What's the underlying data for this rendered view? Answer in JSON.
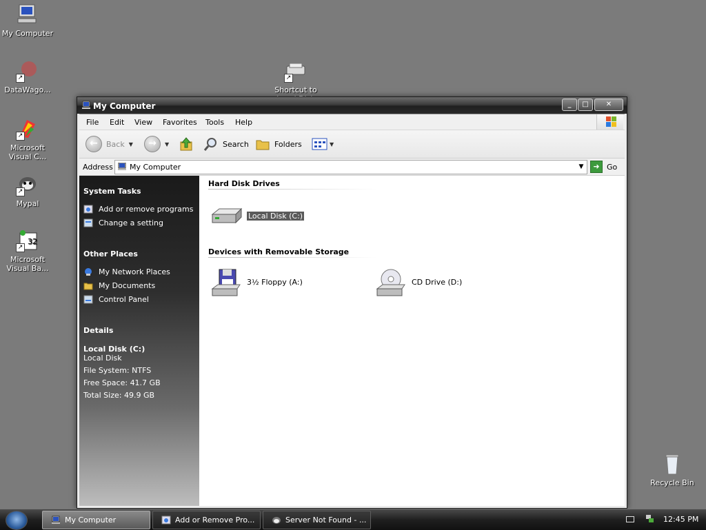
{
  "desktop": {
    "icons": [
      {
        "label": "My Computer",
        "icon": "my-computer-icon"
      },
      {
        "label": "DataWago...",
        "icon": "datawagon-icon"
      },
      {
        "label": "Shortcut to Local Disk (C...",
        "icon": "drive-shortcut-icon"
      },
      {
        "label": "Microsoft Visual C...",
        "icon": "visual-c-icon"
      },
      {
        "label": "Mypal",
        "icon": "mypal-icon"
      },
      {
        "label": "Microsoft Visual Ba...",
        "icon": "visual-basic-icon"
      },
      {
        "label": "Recycle Bin",
        "icon": "recycle-bin-icon"
      }
    ]
  },
  "window": {
    "title": "My Computer",
    "menu": [
      "File",
      "Edit",
      "View",
      "Favorites",
      "Tools",
      "Help"
    ],
    "toolbar": {
      "back": "Back",
      "search": "Search",
      "folders": "Folders"
    },
    "address": {
      "label": "Address",
      "value": "My Computer",
      "go": "Go"
    }
  },
  "tasks": {
    "system_tasks": {
      "title": "System Tasks",
      "items": [
        "Add or remove programs",
        "Change a setting"
      ]
    },
    "other_places": {
      "title": "Other Places",
      "items": [
        "My Network Places",
        "My Documents",
        "Control Panel"
      ]
    },
    "details": {
      "title": "Details",
      "name": "Local Disk (C:)",
      "type": "Local Disk",
      "file_system": "File System: NTFS",
      "free_space": "Free Space: 41.7 GB",
      "total_size": "Total Size: 49.9 GB"
    }
  },
  "content": {
    "hard_disk_group": "Hard Disk Drives",
    "hard_disks": [
      {
        "label": "Local Disk (C:)",
        "selected": true
      }
    ],
    "removable_group": "Devices with Removable Storage",
    "removable": [
      {
        "label": "3½ Floppy (A:)"
      },
      {
        "label": "CD Drive (D:)"
      }
    ]
  },
  "taskbar": {
    "buttons": [
      {
        "label": "My Computer",
        "active": true
      },
      {
        "label": "Add or Remove Pro...",
        "active": false
      },
      {
        "label": "Server Not Found - ...",
        "active": false
      }
    ],
    "clock": "12:45 PM"
  },
  "colors": {
    "desktop": "#7b7b7b",
    "task_pane_top": "#1a1a1a",
    "selection": "#5a5a5a"
  }
}
